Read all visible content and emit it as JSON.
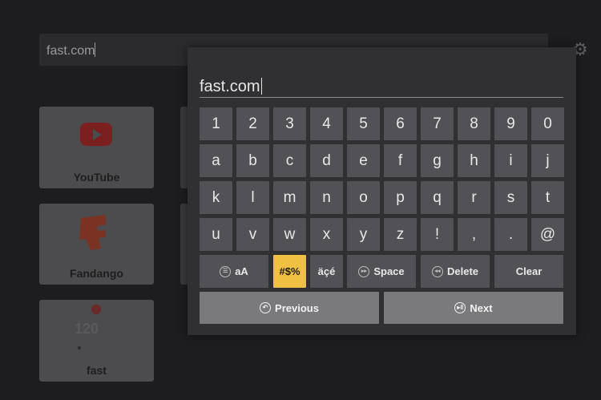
{
  "background": {
    "search_text": "fast.com",
    "gear_icon": "gear-icon",
    "tiles": [
      {
        "label": "YouTube",
        "icon": "youtube-icon"
      },
      {
        "label": "Fandango",
        "icon": "fandango-icon"
      },
      {
        "label": "fast",
        "icon": "fast-icon",
        "value_text": "120"
      }
    ]
  },
  "keyboard": {
    "input_value": "fast.com",
    "rows": [
      [
        "1",
        "2",
        "3",
        "4",
        "5",
        "6",
        "7",
        "8",
        "9",
        "0"
      ],
      [
        "a",
        "b",
        "c",
        "d",
        "e",
        "f",
        "g",
        "h",
        "i",
        "j"
      ],
      [
        "k",
        "l",
        "m",
        "n",
        "o",
        "p",
        "q",
        "r",
        "s",
        "t"
      ],
      [
        "u",
        "v",
        "w",
        "x",
        "y",
        "z",
        "!",
        ",",
        ".",
        "@"
      ]
    ],
    "function_keys": {
      "case_label": "aA",
      "symbols_label": "#$%",
      "accents_label": "äçé",
      "space_label": "Space",
      "delete_label": "Delete",
      "clear_label": "Clear"
    },
    "previous_label": "Previous",
    "next_label": "Next",
    "accent_color": "#f0c043"
  }
}
